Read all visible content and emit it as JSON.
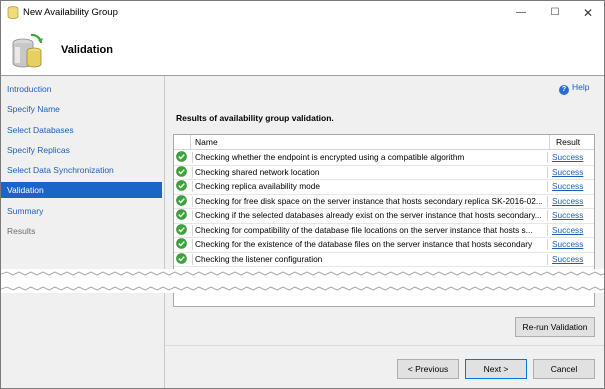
{
  "window": {
    "title": "New Availability Group",
    "min_glyph": "—",
    "max_glyph": "☐",
    "close_glyph": "✕"
  },
  "header": {
    "title": "Validation"
  },
  "sidebar": {
    "items": [
      {
        "label": "Introduction",
        "state": "link"
      },
      {
        "label": "Specify Name",
        "state": "link"
      },
      {
        "label": "Select Databases",
        "state": "link"
      },
      {
        "label": "Specify Replicas",
        "state": "link"
      },
      {
        "label": "Select Data Synchronization",
        "state": "link"
      },
      {
        "label": "Validation",
        "state": "active"
      },
      {
        "label": "Summary",
        "state": "link"
      },
      {
        "label": "Results",
        "state": "disabled"
      }
    ]
  },
  "main": {
    "help_label": "Help",
    "results_label": "Results of availability group validation.",
    "columns": {
      "name": "Name",
      "result": "Result"
    },
    "rows": [
      {
        "name": "Checking whether the endpoint is encrypted using a compatible algorithm",
        "result": "Success"
      },
      {
        "name": "Checking shared network location",
        "result": "Success"
      },
      {
        "name": "Checking replica availability mode",
        "result": "Success"
      },
      {
        "name": "Checking for free disk space on the server instance that hosts secondary replica SK-2016-02...",
        "result": "Success"
      },
      {
        "name": "Checking if the selected databases already exist on the server instance that hosts secondary...",
        "result": "Success"
      },
      {
        "name": "Checking for compatibility of the database file locations on the server instance that hosts s...",
        "result": "Success"
      },
      {
        "name": "Checking for the existence of the database files on the server instance that hosts secondary",
        "result": "Success"
      },
      {
        "name": "Checking the listener configuration",
        "result": "Success"
      }
    ]
  },
  "buttons": {
    "rerun": "Re-run Validation",
    "previous": "< Previous",
    "next": "Next >",
    "cancel": "Cancel"
  },
  "colors": {
    "accent": "#1c64c8",
    "link": "#1e5fb3",
    "success_icon": "#3aa63a"
  }
}
